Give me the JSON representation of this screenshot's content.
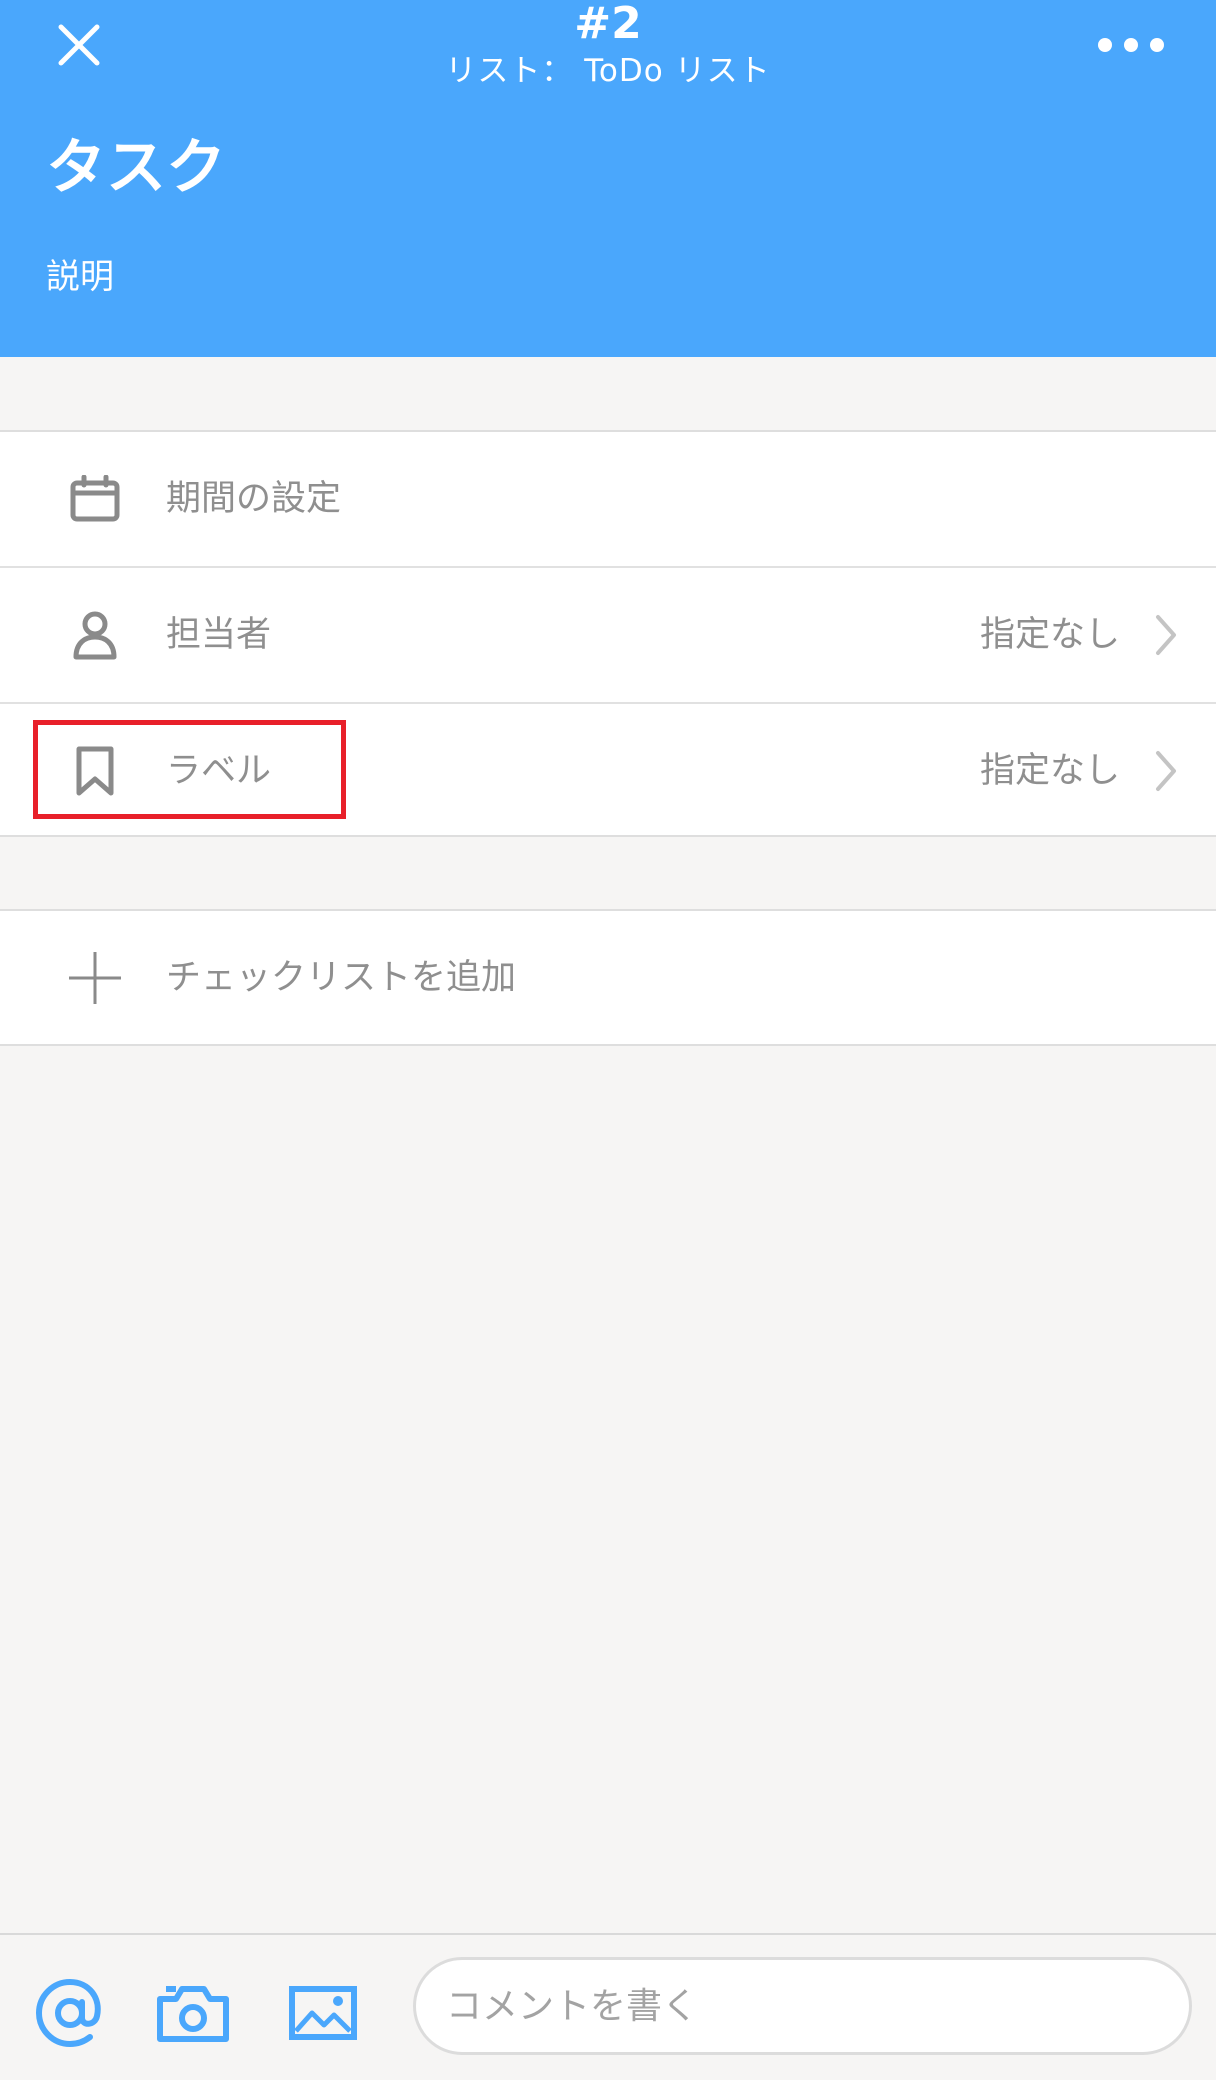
{
  "header": {
    "task_number": "#2",
    "list_name": "リスト： ToDo リスト",
    "title": "タスク",
    "description": "説明",
    "close_icon": "close-icon",
    "more_icon": "more-horizontal-icon"
  },
  "fields": {
    "period": {
      "label": "期間の設定",
      "icon": "calendar-icon"
    },
    "assignee": {
      "label": "担当者",
      "value": "指定なし",
      "icon": "person-icon"
    },
    "label": {
      "label": "ラベル",
      "value": "指定なし",
      "icon": "bookmark-icon"
    }
  },
  "checklist": {
    "label": "チェックリストを追加",
    "icon": "plus-icon"
  },
  "bottom_bar": {
    "mention_icon": "at-sign-icon",
    "camera_icon": "camera-icon",
    "image_icon": "image-icon",
    "comment_placeholder": "コメントを書く"
  },
  "colors": {
    "header_bg": "#4aa7fc",
    "accent": "#4aa7fc",
    "highlight": "#e8202a",
    "muted_text": "#8f8f8f"
  }
}
